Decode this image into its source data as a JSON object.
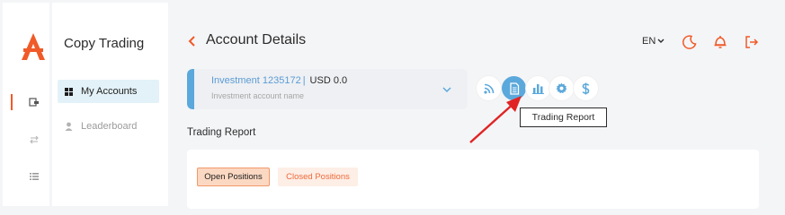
{
  "app": {
    "title": "Copy Trading",
    "brand_color": "#f05a28",
    "accent_color": "#5ba8dc"
  },
  "rail": {
    "icons": [
      "wallet-icon",
      "exchange-icon",
      "list-icon"
    ],
    "active_index": 0
  },
  "sidebar": {
    "items": [
      {
        "label": "My Accounts",
        "icon": "grid-icon",
        "active": true
      },
      {
        "label": "Leaderboard",
        "icon": "user-icon",
        "active": false
      }
    ]
  },
  "header": {
    "title": "Account Details",
    "language": "EN",
    "icons": [
      "moon-icon",
      "bell-icon",
      "logout-icon"
    ]
  },
  "account": {
    "name": "Investment 1235172",
    "separator": "|",
    "balance": "USD 0.0",
    "label": "Investment account name"
  },
  "toolbar": {
    "buttons": [
      "rss-icon",
      "document-icon",
      "bar-chart-icon",
      "gear-icon",
      "dollar-icon"
    ],
    "active": "document-icon",
    "tooltip": "Trading Report"
  },
  "report": {
    "title": "Trading Report",
    "tabs": [
      {
        "label": "Open Positions",
        "active": true
      },
      {
        "label": "Closed Positions",
        "active": false
      }
    ]
  }
}
